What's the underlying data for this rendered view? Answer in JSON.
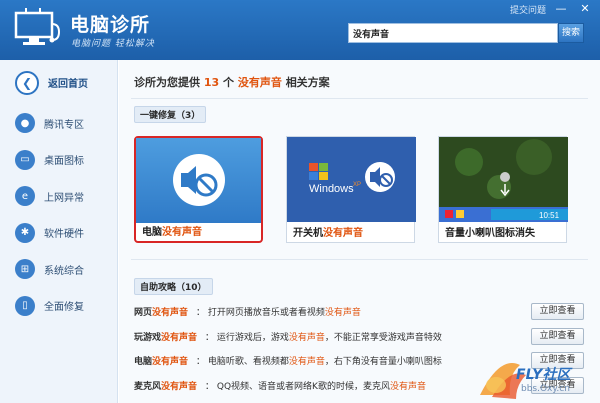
{
  "app": {
    "name": "电脑诊所",
    "tagline": "电脑问题 轻松解决",
    "feedback": "提交问题",
    "minimize": "—",
    "close": "✕"
  },
  "search": {
    "value": "没有声音",
    "button": "搜索"
  },
  "sidebar": {
    "items": [
      {
        "label": "返回首页",
        "icon": "back-arrow-icon",
        "glyph": "❮"
      },
      {
        "label": "腾讯专区",
        "icon": "penguin-icon",
        "glyph": "●"
      },
      {
        "label": "桌面图标",
        "icon": "monitor-icon",
        "glyph": "▭"
      },
      {
        "label": "上网异常",
        "icon": "ie-icon",
        "glyph": "e"
      },
      {
        "label": "软件硬件",
        "icon": "gear-icon",
        "glyph": "✱"
      },
      {
        "label": "系统综合",
        "icon": "windows-icon",
        "glyph": "⊞"
      },
      {
        "label": "全面修复",
        "icon": "phone-icon",
        "glyph": "▯"
      }
    ]
  },
  "headline": {
    "prefix": "诊所为您提供",
    "count": "13",
    "unit": "个",
    "keyword": "没有声音",
    "suffix": "相关方案"
  },
  "section1": {
    "title": "一键修复（3）"
  },
  "cards": [
    {
      "cap_pre": "电脑",
      "cap_red": "没有声音",
      "cap_post": ""
    },
    {
      "cap_pre": "开关机",
      "cap_red": "没有声音",
      "cap_post": "",
      "logo": "Windows",
      "logo_suffix": "XP"
    },
    {
      "cap_pre": "音量小喇叭图标消失",
      "cap_red": "",
      "cap_post": "",
      "clock": "10:51"
    }
  ],
  "section2": {
    "title": "自助攻略（10）"
  },
  "guides": [
    {
      "title_pre": "网页",
      "title_red": "没有声音",
      "desc_pre": "：  打开网页播放音乐或者看视频",
      "desc_red": "没有声音",
      "desc_post": "",
      "button": "立即查看"
    },
    {
      "title_pre": "玩游戏",
      "title_red": "没有声音",
      "desc_pre": "：  运行游戏后，游戏",
      "desc_red": "没有声音",
      "desc_post": "，不能正常享受游戏声音特效",
      "button": "立即查看"
    },
    {
      "title_pre": "电脑",
      "title_red": "没有声音",
      "desc_pre": "：  电脑听歌、看视频都",
      "desc_red": "没有声音",
      "desc_post": "，右下角没有音量小喇叭图标",
      "button": "立即查看"
    },
    {
      "title_pre": "麦克风",
      "title_red": "没有声音",
      "desc_pre": "：  QQ视频、语音或者网络K歌的时候，麦克风",
      "desc_red": "没有声音",
      "desc_post": "",
      "button": "立即查看"
    }
  ],
  "watermark": {
    "brand": "FLY社区",
    "url": "bbs.Oxy.cn"
  },
  "colors": {
    "accent": "#2b78c6",
    "highlight": "#e0540f",
    "selected": "#d82626"
  }
}
